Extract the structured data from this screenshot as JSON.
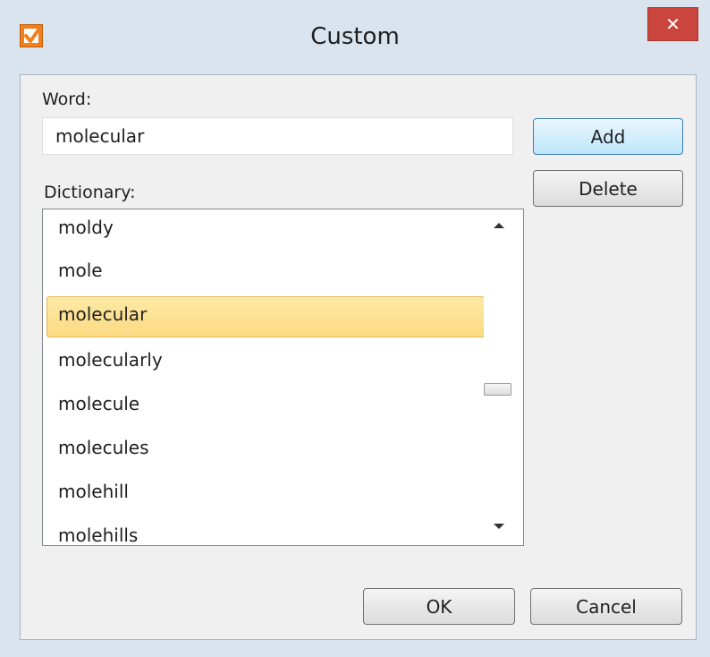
{
  "window": {
    "title": "Custom",
    "close_glyph": "✕",
    "icon": "checkbox-icon"
  },
  "form": {
    "word_label": "Word:",
    "word_value": "molecular",
    "dictionary_label": "Dictionary:"
  },
  "buttons": {
    "add": "Add",
    "delete": "Delete",
    "ok": "OK",
    "cancel": "Cancel"
  },
  "dictionary": {
    "items": [
      "moldy",
      "mole",
      "molecular",
      "molecularly",
      "molecule",
      "molecules",
      "molehill",
      "molehills"
    ],
    "selected": "molecular"
  },
  "colors": {
    "accent": "#f0801e",
    "close": "#c9453d",
    "selection": "#fde9a5"
  }
}
